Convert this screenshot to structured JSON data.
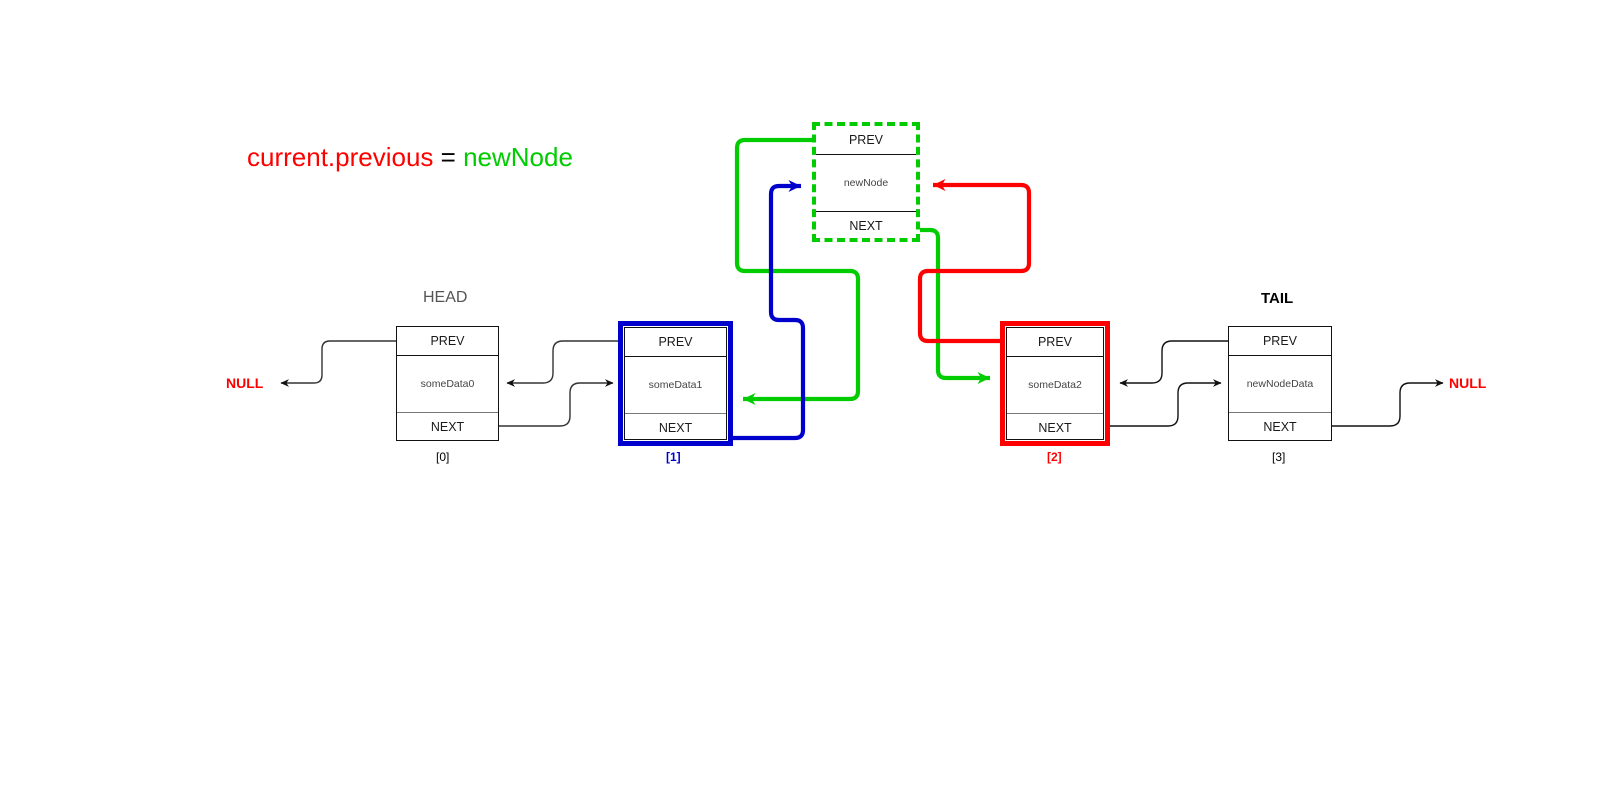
{
  "diagram": {
    "title": {
      "part1": "current.previous",
      "part1_color": "#ff0000",
      "operator": " = ",
      "part2": "newNode",
      "part2_color": "#00cc00"
    },
    "labels": {
      "head": "HEAD",
      "tail": "TAIL",
      "null_left": "NULL",
      "null_right": "NULL"
    },
    "field_labels": {
      "prev": "PREV",
      "next": "NEXT"
    },
    "nodes": [
      {
        "index_label": "[0]",
        "data": "someData0",
        "prev": "PREV",
        "next": "NEXT",
        "style": "plain",
        "marker": "HEAD"
      },
      {
        "index_label": "[1]",
        "data": "someData1",
        "prev": "PREV",
        "next": "NEXT",
        "style": "blue",
        "border_color": "#0000cc"
      },
      {
        "index_label": "[2]",
        "data": "someData2",
        "prev": "PREV",
        "next": "NEXT",
        "style": "red",
        "border_color": "#ff0000"
      },
      {
        "index_label": "[3]",
        "data": "newNodeData",
        "prev": "PREV",
        "next": "NEXT",
        "style": "plain",
        "marker": "TAIL"
      }
    ],
    "new_node": {
      "data": "newNode",
      "prev": "PREV",
      "next": "NEXT",
      "border_color": "#00cc00",
      "border_style": "dashed"
    },
    "colors": {
      "red": "#ff0000",
      "green": "#00cc00",
      "blue": "#0000cc",
      "black": "#111111",
      "gray": "#555555"
    }
  }
}
